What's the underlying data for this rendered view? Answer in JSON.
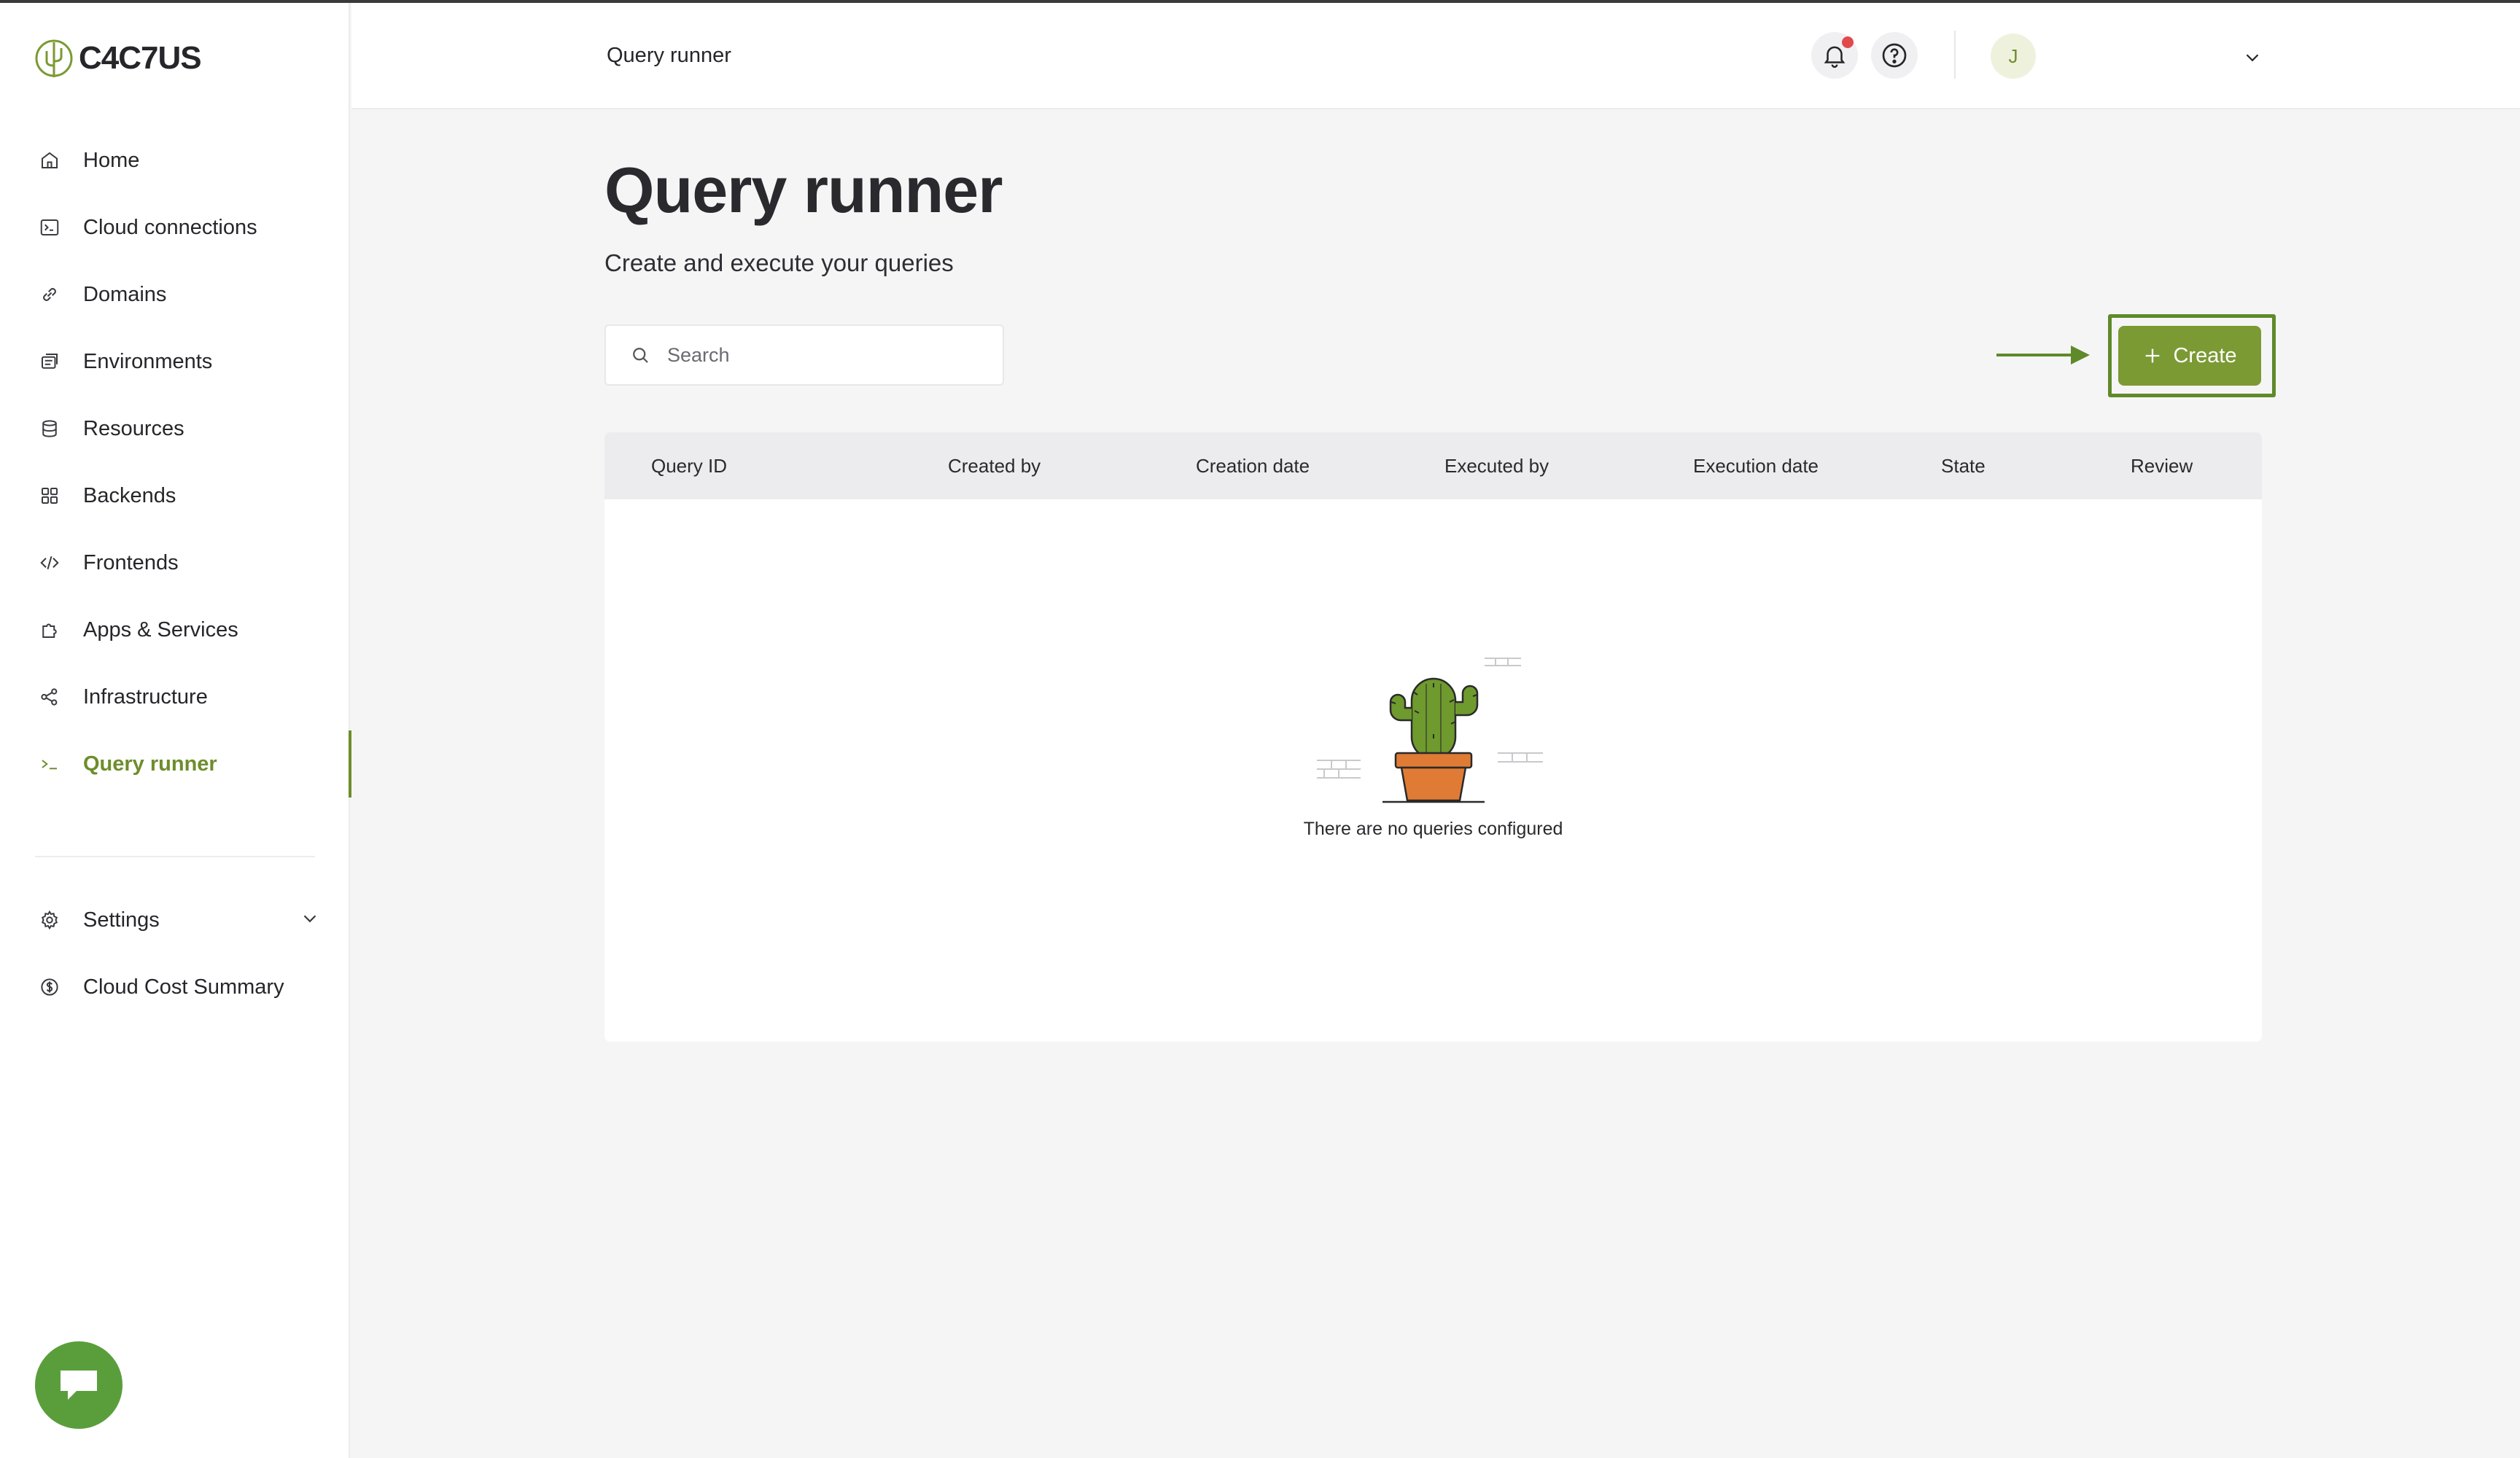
{
  "brand": {
    "name": "C4C7US"
  },
  "sidebar": {
    "items": [
      {
        "label": "Home",
        "icon": "home-icon"
      },
      {
        "label": "Cloud connections",
        "icon": "terminal-box-icon"
      },
      {
        "label": "Domains",
        "icon": "link-icon"
      },
      {
        "label": "Environments",
        "icon": "environments-icon"
      },
      {
        "label": "Resources",
        "icon": "database-icon"
      },
      {
        "label": "Backends",
        "icon": "grid-icon"
      },
      {
        "label": "Frontends",
        "icon": "code-icon"
      },
      {
        "label": "Apps & Services",
        "icon": "puzzle-icon"
      },
      {
        "label": "Infrastructure",
        "icon": "nodes-icon"
      },
      {
        "label": "Query runner",
        "icon": "prompt-icon",
        "active": true
      }
    ],
    "bottom_items": [
      {
        "label": "Settings",
        "icon": "gear-icon"
      },
      {
        "label": "Cloud Cost Summary",
        "icon": "dollar-circle-icon"
      }
    ]
  },
  "header": {
    "breadcrumb": "Query runner",
    "avatar_initial": "J"
  },
  "main": {
    "title": "Query runner",
    "subtitle": "Create and execute your queries",
    "search_placeholder": "Search",
    "create_label": "Create",
    "table": {
      "columns": [
        "Query ID",
        "Created by",
        "Creation date",
        "Executed by",
        "Execution date",
        "State",
        "Review"
      ],
      "rows": [],
      "empty_message": "There are no queries configured"
    }
  },
  "colors": {
    "accent": "#7b9a33",
    "active_nav": "#6e8d2c",
    "notification": "#e04a4a",
    "chat": "#5a9e3c"
  }
}
